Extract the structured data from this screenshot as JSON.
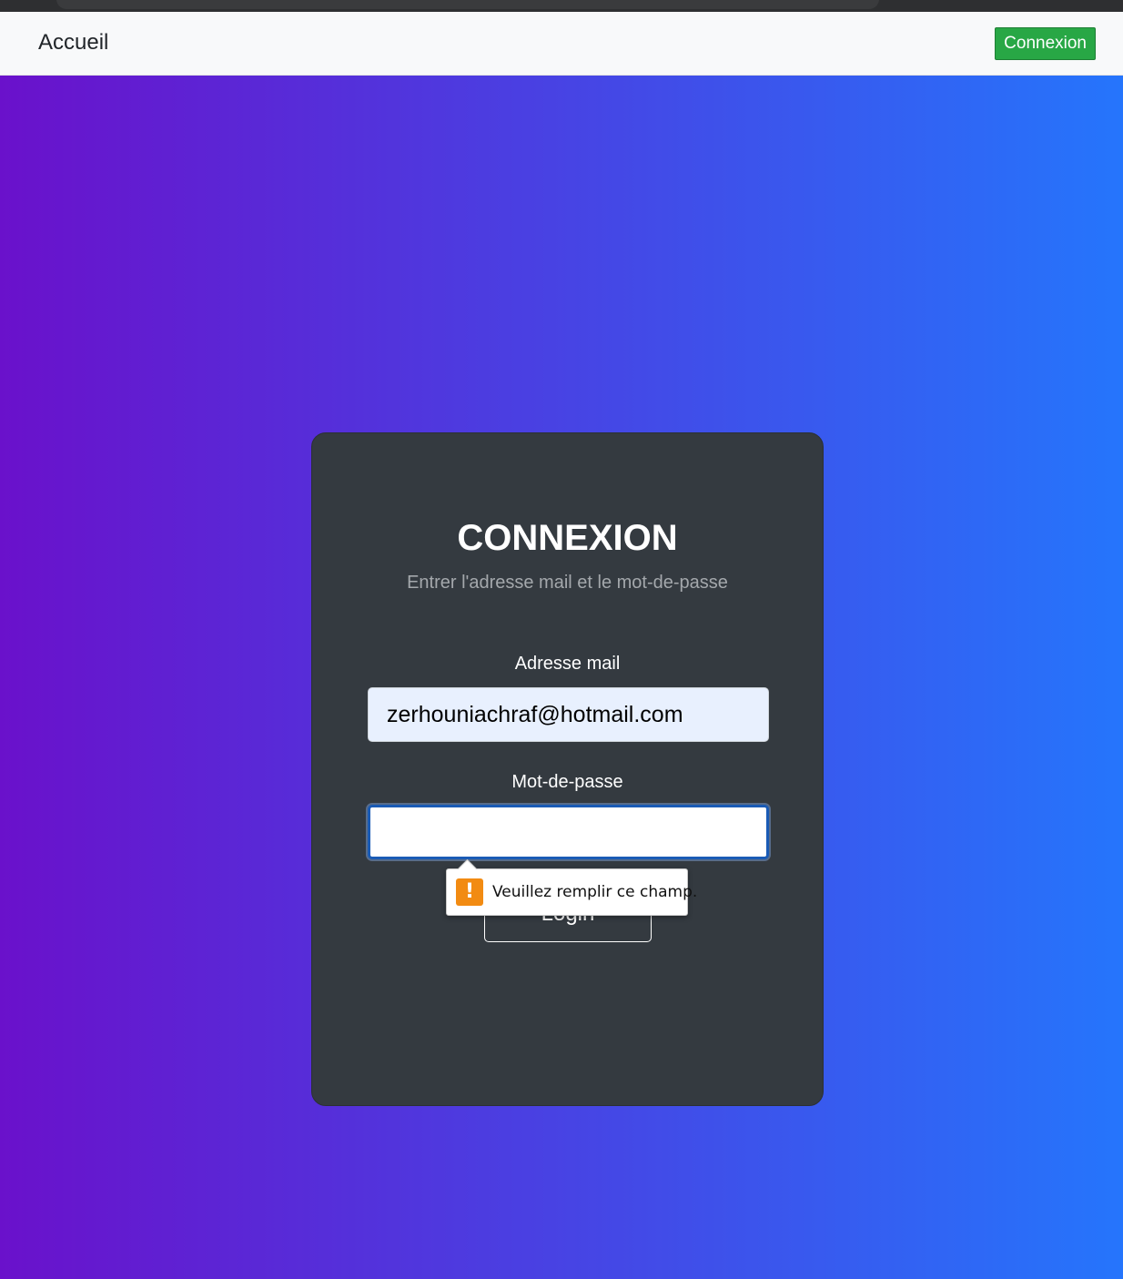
{
  "navbar": {
    "brand": "Accueil",
    "connexion_button": "Connexion"
  },
  "login_card": {
    "title": "CONNEXION",
    "subtitle": "Entrer l'adresse mail et le mot-de-passe",
    "email_label": "Adresse mail",
    "email_value": "zerhouniachraf@hotmail.com",
    "password_label": "Mot-de-passe",
    "password_value": "",
    "login_button": "Login"
  },
  "validation_tooltip": {
    "icon": "warning-icon",
    "message": "Veuillez remplir ce champ."
  },
  "colors": {
    "gradient_start": "#6a11cb",
    "gradient_end": "#2575fc",
    "card_background": "#343a40",
    "nav_button": "#28a745",
    "warning": "#f28b12"
  }
}
